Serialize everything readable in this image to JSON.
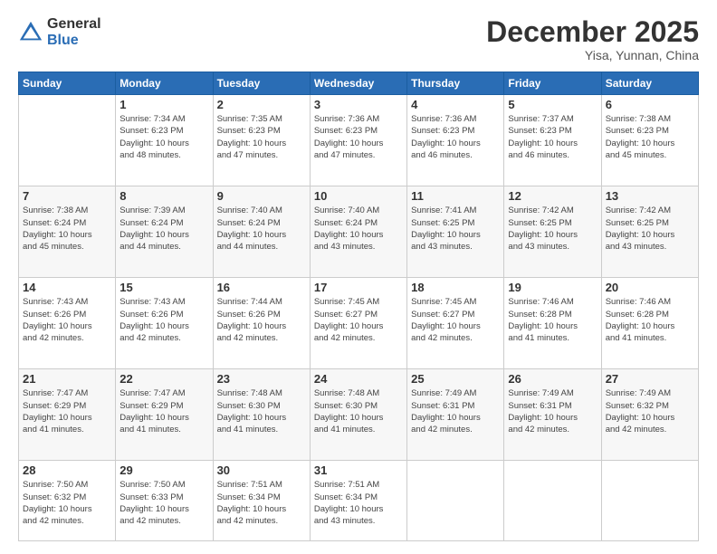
{
  "header": {
    "logo_general": "General",
    "logo_blue": "Blue",
    "month_title": "December 2025",
    "location": "Yisa, Yunnan, China"
  },
  "days_of_week": [
    "Sunday",
    "Monday",
    "Tuesday",
    "Wednesday",
    "Thursday",
    "Friday",
    "Saturday"
  ],
  "weeks": [
    [
      {
        "day": "",
        "info": ""
      },
      {
        "day": "1",
        "info": "Sunrise: 7:34 AM\nSunset: 6:23 PM\nDaylight: 10 hours\nand 48 minutes."
      },
      {
        "day": "2",
        "info": "Sunrise: 7:35 AM\nSunset: 6:23 PM\nDaylight: 10 hours\nand 47 minutes."
      },
      {
        "day": "3",
        "info": "Sunrise: 7:36 AM\nSunset: 6:23 PM\nDaylight: 10 hours\nand 47 minutes."
      },
      {
        "day": "4",
        "info": "Sunrise: 7:36 AM\nSunset: 6:23 PM\nDaylight: 10 hours\nand 46 minutes."
      },
      {
        "day": "5",
        "info": "Sunrise: 7:37 AM\nSunset: 6:23 PM\nDaylight: 10 hours\nand 46 minutes."
      },
      {
        "day": "6",
        "info": "Sunrise: 7:38 AM\nSunset: 6:23 PM\nDaylight: 10 hours\nand 45 minutes."
      }
    ],
    [
      {
        "day": "7",
        "info": "Sunrise: 7:38 AM\nSunset: 6:24 PM\nDaylight: 10 hours\nand 45 minutes."
      },
      {
        "day": "8",
        "info": "Sunrise: 7:39 AM\nSunset: 6:24 PM\nDaylight: 10 hours\nand 44 minutes."
      },
      {
        "day": "9",
        "info": "Sunrise: 7:40 AM\nSunset: 6:24 PM\nDaylight: 10 hours\nand 44 minutes."
      },
      {
        "day": "10",
        "info": "Sunrise: 7:40 AM\nSunset: 6:24 PM\nDaylight: 10 hours\nand 43 minutes."
      },
      {
        "day": "11",
        "info": "Sunrise: 7:41 AM\nSunset: 6:25 PM\nDaylight: 10 hours\nand 43 minutes."
      },
      {
        "day": "12",
        "info": "Sunrise: 7:42 AM\nSunset: 6:25 PM\nDaylight: 10 hours\nand 43 minutes."
      },
      {
        "day": "13",
        "info": "Sunrise: 7:42 AM\nSunset: 6:25 PM\nDaylight: 10 hours\nand 43 minutes."
      }
    ],
    [
      {
        "day": "14",
        "info": "Sunrise: 7:43 AM\nSunset: 6:26 PM\nDaylight: 10 hours\nand 42 minutes."
      },
      {
        "day": "15",
        "info": "Sunrise: 7:43 AM\nSunset: 6:26 PM\nDaylight: 10 hours\nand 42 minutes."
      },
      {
        "day": "16",
        "info": "Sunrise: 7:44 AM\nSunset: 6:26 PM\nDaylight: 10 hours\nand 42 minutes."
      },
      {
        "day": "17",
        "info": "Sunrise: 7:45 AM\nSunset: 6:27 PM\nDaylight: 10 hours\nand 42 minutes."
      },
      {
        "day": "18",
        "info": "Sunrise: 7:45 AM\nSunset: 6:27 PM\nDaylight: 10 hours\nand 42 minutes."
      },
      {
        "day": "19",
        "info": "Sunrise: 7:46 AM\nSunset: 6:28 PM\nDaylight: 10 hours\nand 41 minutes."
      },
      {
        "day": "20",
        "info": "Sunrise: 7:46 AM\nSunset: 6:28 PM\nDaylight: 10 hours\nand 41 minutes."
      }
    ],
    [
      {
        "day": "21",
        "info": "Sunrise: 7:47 AM\nSunset: 6:29 PM\nDaylight: 10 hours\nand 41 minutes."
      },
      {
        "day": "22",
        "info": "Sunrise: 7:47 AM\nSunset: 6:29 PM\nDaylight: 10 hours\nand 41 minutes."
      },
      {
        "day": "23",
        "info": "Sunrise: 7:48 AM\nSunset: 6:30 PM\nDaylight: 10 hours\nand 41 minutes."
      },
      {
        "day": "24",
        "info": "Sunrise: 7:48 AM\nSunset: 6:30 PM\nDaylight: 10 hours\nand 41 minutes."
      },
      {
        "day": "25",
        "info": "Sunrise: 7:49 AM\nSunset: 6:31 PM\nDaylight: 10 hours\nand 42 minutes."
      },
      {
        "day": "26",
        "info": "Sunrise: 7:49 AM\nSunset: 6:31 PM\nDaylight: 10 hours\nand 42 minutes."
      },
      {
        "day": "27",
        "info": "Sunrise: 7:49 AM\nSunset: 6:32 PM\nDaylight: 10 hours\nand 42 minutes."
      }
    ],
    [
      {
        "day": "28",
        "info": "Sunrise: 7:50 AM\nSunset: 6:32 PM\nDaylight: 10 hours\nand 42 minutes."
      },
      {
        "day": "29",
        "info": "Sunrise: 7:50 AM\nSunset: 6:33 PM\nDaylight: 10 hours\nand 42 minutes."
      },
      {
        "day": "30",
        "info": "Sunrise: 7:51 AM\nSunset: 6:34 PM\nDaylight: 10 hours\nand 42 minutes."
      },
      {
        "day": "31",
        "info": "Sunrise: 7:51 AM\nSunset: 6:34 PM\nDaylight: 10 hours\nand 43 minutes."
      },
      {
        "day": "",
        "info": ""
      },
      {
        "day": "",
        "info": ""
      },
      {
        "day": "",
        "info": ""
      }
    ]
  ]
}
